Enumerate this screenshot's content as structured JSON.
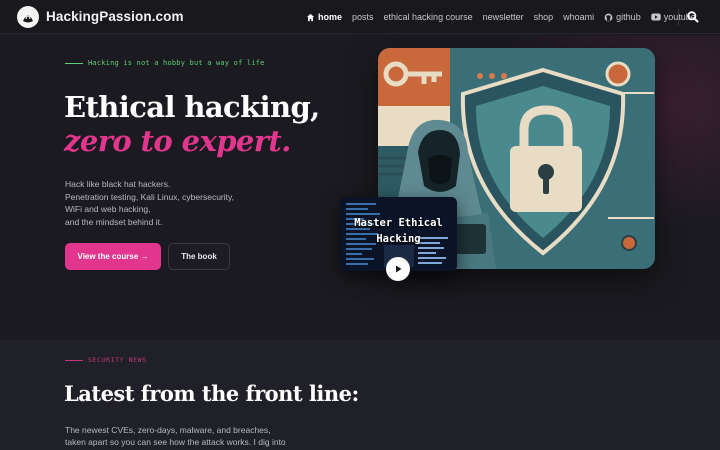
{
  "header": {
    "site_name": "HackingPassion.com",
    "logo_icon": "hacker-mask-icon",
    "nav": [
      {
        "label": "home",
        "icon": "home-icon",
        "active": true
      },
      {
        "label": "posts"
      },
      {
        "label": "ethical hacking course"
      },
      {
        "label": "newsletter"
      },
      {
        "label": "shop"
      },
      {
        "label": "whoami"
      },
      {
        "label": "github",
        "icon": "github-icon"
      },
      {
        "label": "youtube",
        "icon": "youtube-icon"
      }
    ],
    "search_icon": "search-icon"
  },
  "hero": {
    "eyebrow": "Hacking is not a hobby but a way of life",
    "title": "Ethical hacking,",
    "title_accent": "zero to expert.",
    "description": [
      "Hack like black hat hackers.",
      "Penetration testing, Kali Linux, cybersecurity,",
      "WiFi and web hacking,",
      "and the mindset behind it."
    ],
    "primary_button": "View the course →",
    "secondary_button": "The book",
    "video_title_line1": "Master Ethical",
    "video_title_line2": "Hacking"
  },
  "news": {
    "eyebrow": "SECURITY NEWS",
    "title": "Latest from the front line:",
    "description": [
      "The newest CVEs, zero-days, malware, and breaches,",
      "taken apart so you can see how the attack works. I dig into"
    ]
  },
  "colors": {
    "background": "#1a1a20",
    "accent": "#e2368e",
    "eyebrow_green": "#5fcf73",
    "section_bg": "#202028"
  }
}
